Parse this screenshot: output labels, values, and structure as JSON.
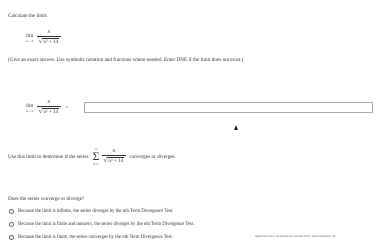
{
  "question": {
    "prompt": "Calculate the limit.",
    "instruction": "(Give an exact answer. Use symbolic notation and fractions where needed. Enter DNE if the limit does not exist.)",
    "limit_word": "lim",
    "limit_sub": "n→∞",
    "numerator": "n",
    "denominator_radicand": "n² + 14",
    "equals": "=",
    "answer_value": ""
  },
  "series_part": {
    "lead": "Use this limit to determine if the series",
    "sum_top": "∞",
    "sum_bottom": "n=1",
    "sum_symbol": "Σ",
    "tail": "converges or diverges."
  },
  "converge_question": "Does the series converge or diverge?",
  "options": [
    {
      "label": "Because the limit is infinite, the series diverges by the nth Term Divergence Test."
    },
    {
      "label": "Because the limit is finite and nonzero, the series diverges by the nth Term Divergence Test."
    },
    {
      "label": "Because the limit is finite, the series converges by the nth Term Divergence Test."
    }
  ],
  "footer": "Question Source: Rogawski 4e Calculus Early Transcendentals | Pu"
}
